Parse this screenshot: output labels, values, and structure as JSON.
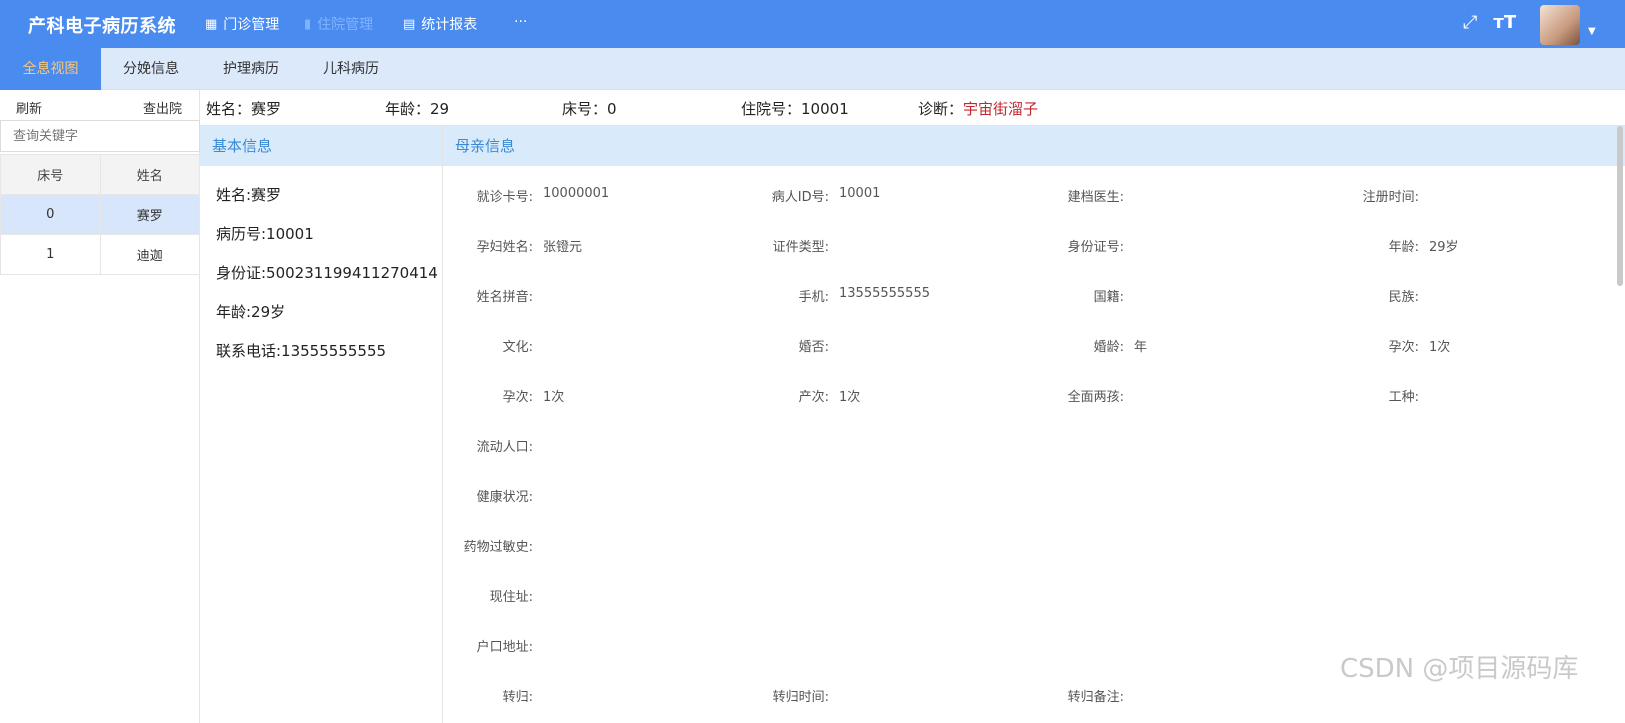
{
  "app": {
    "title": "产科电子病历系统"
  },
  "nav": [
    {
      "label": "门诊管理",
      "icon": "grid-icon"
    },
    {
      "label": "住院管理",
      "icon": "bar-chart-icon"
    },
    {
      "label": "统计报表",
      "icon": "table-icon"
    },
    {
      "label": "···",
      "icon": "more-icon"
    }
  ],
  "header_icons": [
    "fullscreen-icon",
    "font-size-icon"
  ],
  "tabs": [
    "全息视图",
    "分娩信息",
    "护理病历",
    "儿科病历"
  ],
  "left": {
    "refresh": "刷新",
    "discharge": "查出院",
    "search_placeholder": "查询关键字",
    "headers": [
      "床号",
      "姓名"
    ],
    "rows": [
      {
        "bed": "0",
        "name": "赛罗"
      },
      {
        "bed": "1",
        "name": "迪迦"
      }
    ]
  },
  "patient": {
    "name_label": "姓名：",
    "name": "赛罗",
    "age_label": "年龄：",
    "age": "29",
    "bed_label": "床号：",
    "bed": "0",
    "admit_label": "住院号：",
    "admit": "10001",
    "diag_label": "诊断：",
    "diag": "宇宙街溜子"
  },
  "basic": {
    "title": "基本信息",
    "rows": [
      "姓名:赛罗",
      "病历号:10001",
      "身份证:500231199411270414",
      "年龄:29岁",
      "联系电话:13555555555"
    ]
  },
  "mother": {
    "title": "母亲信息",
    "fields": [
      [
        "就诊卡号:",
        "10000001",
        "病人ID号:",
        "10001",
        "建档医生:",
        "",
        "注册时间:",
        ""
      ],
      [
        "孕妇姓名:",
        "张镫元",
        "证件类型:",
        "",
        "身份证号:",
        "",
        "年龄:",
        "29岁"
      ],
      [
        "姓名拼音:",
        "",
        "手机:",
        "13555555555",
        "国籍:",
        "",
        "民族:",
        ""
      ],
      [
        "文化:",
        "",
        "婚否:",
        "",
        "婚龄:",
        "年",
        "孕次:",
        "1次"
      ],
      [
        "孕次:",
        "1次",
        "产次:",
        "1次",
        "全面两孩:",
        "",
        "工种:",
        ""
      ],
      [
        "流动人口:",
        ""
      ],
      [
        "健康状况:",
        ""
      ],
      [
        "药物过敏史:",
        ""
      ],
      [
        "现住址:",
        ""
      ],
      [
        "户口地址:",
        ""
      ],
      [
        "转归:",
        "",
        "转归时间:",
        "",
        "转归备注:",
        ""
      ]
    ]
  },
  "watermark": "CSDN @项目源码库"
}
